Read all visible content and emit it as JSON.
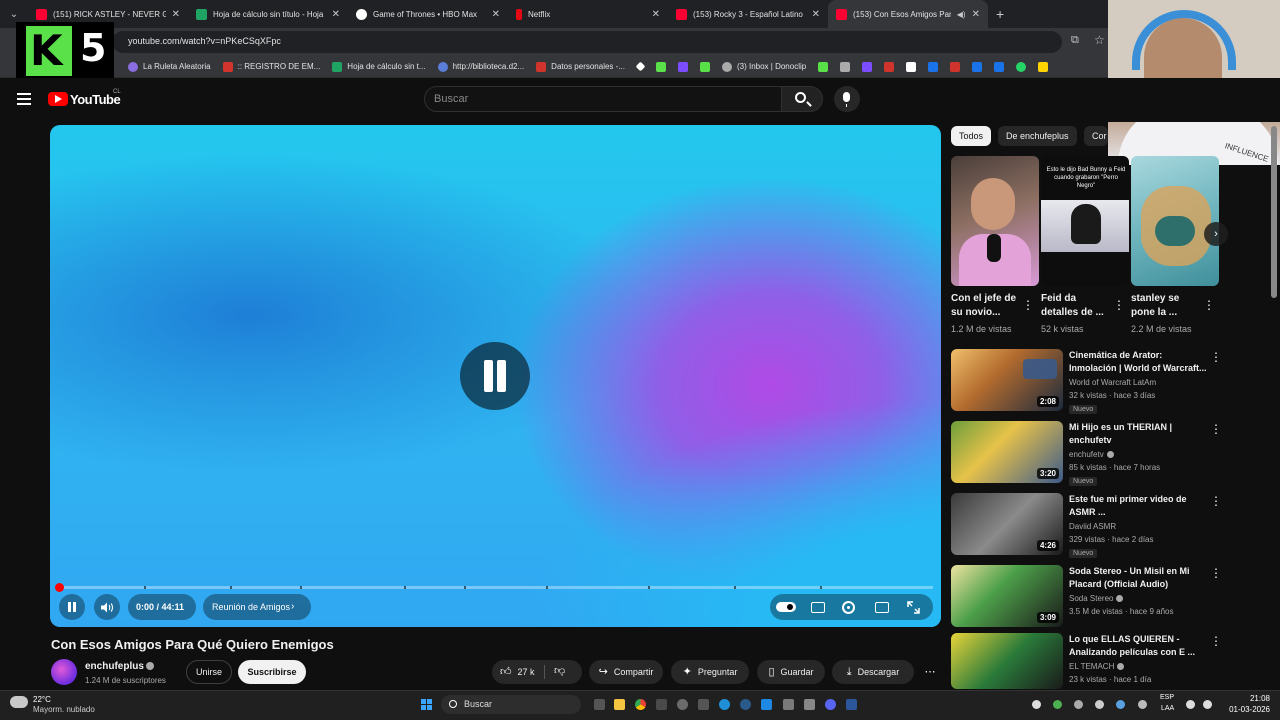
{
  "browser": {
    "tabs": [
      {
        "title": "(151) RICK ASTLEY - NEVER GO",
        "favicon": "youtube-icon",
        "color": "#ff0033",
        "active": false
      },
      {
        "title": "Hoja de cálculo sin título - Hoja",
        "favicon": "sheets-icon",
        "color": "#1fa463",
        "active": false
      },
      {
        "title": "Game of Thrones • HBO Max",
        "favicon": "hbo-icon",
        "color": "#ffffff",
        "active": false
      },
      {
        "title": "Netflix",
        "favicon": "netflix-icon",
        "color": "#e50914",
        "active": false
      },
      {
        "title": "(153) Rocky 3 - Español Latino",
        "favicon": "youtube-icon",
        "color": "#ff0033",
        "active": false
      },
      {
        "title": "(153) Con Esos Amigos Para",
        "favicon": "youtube-icon",
        "color": "#ff0033",
        "active": true
      }
    ],
    "url": "youtube.com/watch?v=nPKeCSqXFpc",
    "bookmarks": [
      {
        "label": "La Ruleta Aleatoria",
        "color": "#8a6de0"
      },
      {
        "label": ":: REGISTRO DE EM...",
        "color": "#d0342c"
      },
      {
        "label": "Hoja de cálculo sin t...",
        "color": "#1fa463"
      },
      {
        "label": "http://biblioteca.d2...",
        "color": "#5b7fd8"
      },
      {
        "label": "Datos personales -...",
        "color": "#d0342c"
      },
      {
        "label": "(3) Inbox | Donoclip",
        "color": "#aaaaaa"
      }
    ],
    "bookmark_icons": [
      "#ffffff",
      "#5ae14a",
      "#7c4dff",
      "#5ae14a",
      "#5ae14a",
      "#aaaaaa",
      "#7c4dff",
      "#d0342c",
      "#ffffff",
      "#1a73e8",
      "#d0342c",
      "#1a73e8",
      "#1a73e8",
      "#25d366",
      "#ffd400"
    ]
  },
  "overlay": {
    "logo_letter": "K",
    "logo_number": "5",
    "webcam_shirt_text": "INFLUENCE"
  },
  "youtube": {
    "logo_text": "YouTube",
    "region": "CL",
    "search_placeholder": "Buscar",
    "player": {
      "current_time": "0:00",
      "duration": "44:11",
      "time_display": "0:00 / 44:11",
      "chapter": "Reunión de Amigos",
      "progress": 0
    },
    "video": {
      "title": "Con Esos Amigos Para Qué Quiero Enemigos",
      "channel": "enchufeplus",
      "subscribers": "1.24 M de suscriptores",
      "join_label": "Unirse",
      "subscribe_label": "Suscribirse",
      "likes": "27 k",
      "share_label": "Compartir",
      "ask_label": "Preguntar",
      "save_label": "Guardar",
      "download_label": "Descargar"
    },
    "chips": [
      {
        "label": "Todos",
        "selected": true
      },
      {
        "label": "De enchufeplus",
        "selected": false
      },
      {
        "label": "Cor",
        "selected": false
      }
    ],
    "shorts": [
      {
        "title": "Con el jefe de su novio...",
        "views": "1.2 M de vistas"
      },
      {
        "title": "Feid da detalles de ...",
        "views": "52 k vistas",
        "caption": "Esto le dijo Bad Bunny a Feid cuando grabaron \"Perro Negro\""
      },
      {
        "title": "stanley se pone la ...",
        "views": "2.2 M de vistas"
      }
    ],
    "recommendations": [
      {
        "title": "Cinemática de Arator: Inmolación | World of Warcraft...",
        "channel": "World of Warcraft LatAm",
        "verified": false,
        "meta": "32 k vistas · hace 3 días",
        "duration": "2:08",
        "new": "Nuevo"
      },
      {
        "title": "Mi Hijo es un THERIAN | enchufetv",
        "channel": "enchufetv",
        "verified": true,
        "meta": "85 k vistas · hace 7 horas",
        "duration": "3:20",
        "new": "Nuevo"
      },
      {
        "title": "Este fue mi primer video de ASMR ...",
        "channel": "Daviid ASMR",
        "verified": false,
        "meta": "329 vistas · hace 2 días",
        "duration": "4:26",
        "new": "Nuevo"
      },
      {
        "title": "Soda Stereo - Un Misil en Mi Placard (Official Audio)",
        "channel": "Soda Stereo",
        "verified": true,
        "meta": "3.5 M de vistas · hace 9 años",
        "duration": "3:09",
        "new": ""
      },
      {
        "title": "Lo que ELLAS QUIEREN - Analizando películas con E ...",
        "channel": "EL TEMACH",
        "verified": true,
        "meta": "23 k vistas · hace 1 día",
        "duration": "",
        "new": ""
      }
    ]
  },
  "taskbar": {
    "temperature": "22°C",
    "weather": "Mayorm. nublado",
    "search_label": "Buscar",
    "lang": "ESP",
    "lang2": "LAA",
    "time": "21:08",
    "date": "01-03-2026"
  }
}
